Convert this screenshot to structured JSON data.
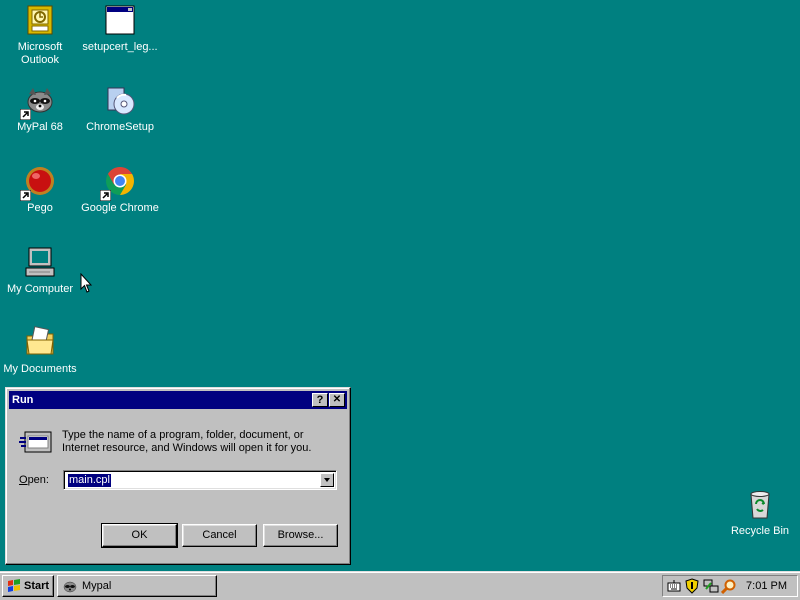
{
  "desktop": {
    "background": "#008080",
    "icons": [
      {
        "label": "Microsoft\nOutlook",
        "icon": "outlook-icon"
      },
      {
        "label": "setupcert_leg...",
        "icon": "window-app-icon"
      },
      {
        "label": "MyPal 68",
        "icon": "mypal-raccoon-icon"
      },
      {
        "label": "ChromeSetup",
        "icon": "installer-cd-icon"
      },
      {
        "label": "Pego",
        "icon": "pego-red-ball-icon"
      },
      {
        "label": "Google Chrome",
        "icon": "chrome-icon"
      },
      {
        "label": "My Computer",
        "icon": "computer-icon"
      },
      {
        "label": "My Documents",
        "icon": "folder-documents-icon"
      },
      {
        "label": "Recycle Bin",
        "icon": "recycle-bin-icon"
      }
    ]
  },
  "run_dialog": {
    "title": "Run",
    "help_button": "?",
    "close_button": "✕",
    "description": "Type the name of a program, folder, document, or Internet resource, and Windows will open it for you.",
    "open_label_prefix": "",
    "open_label_accel": "O",
    "open_label_rest": "pen:",
    "open_value": "main.cpl",
    "ok_label": "OK",
    "cancel_label": "Cancel",
    "browse_label": "Browse..."
  },
  "taskbar": {
    "start_label": "Start",
    "tasks": [
      {
        "label": "Mypal",
        "icon": "mypal-raccoon-icon"
      }
    ],
    "tray_icons": [
      "keyboard-icon",
      "shield-icon",
      "network-icon",
      "search-icon"
    ],
    "clock": "7:01 PM"
  },
  "colors": {
    "titlebar": "#000080",
    "face": "#c0c0c0",
    "selection": "#000080"
  }
}
